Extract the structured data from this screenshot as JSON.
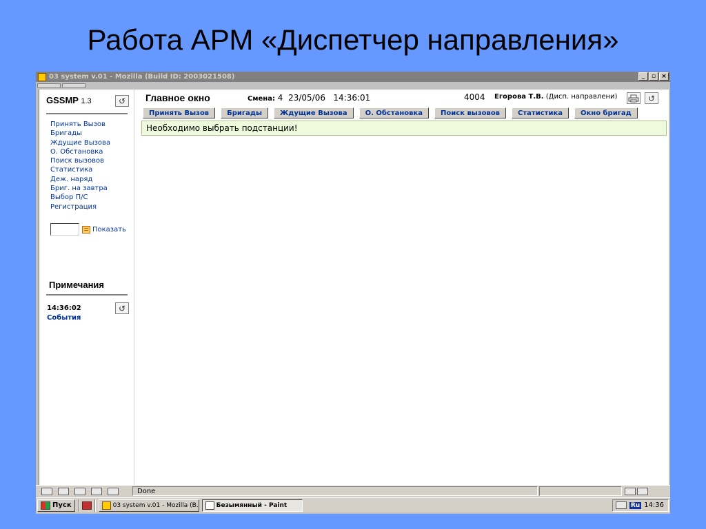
{
  "slide": {
    "title": "Работа АРМ «Диспетчер направления»"
  },
  "window": {
    "title": "03 system v.01 - Mozilla (Build ID: 2003021508)",
    "min_label": "_",
    "max_label": "▫",
    "close_label": "×"
  },
  "sidebar": {
    "brand": "GSSMP",
    "version": "1.3",
    "refresh_glyph": "↺",
    "items": [
      {
        "label": "Принять Вызов"
      },
      {
        "label": "Бригады"
      },
      {
        "label": "Ждущие Вызова"
      },
      {
        "label": "О. Обстановка"
      },
      {
        "label": "Поиск вызовов"
      },
      {
        "label": "Статистика"
      },
      {
        "label": "Деж. наряд"
      },
      {
        "label": "Бриг. на завтра"
      },
      {
        "label": "Выбор П/С"
      },
      {
        "label": "Регистрация"
      }
    ],
    "show_label": "Показать",
    "notes_title": "Примечания",
    "note_time": "14:36:02",
    "events_label": "События"
  },
  "header": {
    "title": "Главное окно",
    "shift_label": "Смена:",
    "shift_value": "4",
    "date": "23/05/06",
    "time": "14:36:01",
    "code": "4004",
    "user_name": "Егорова Т.В.",
    "user_role": "(Дисп. направлени)"
  },
  "nav": {
    "buttons": [
      {
        "label": "Принять Вызов"
      },
      {
        "label": "Бригады"
      },
      {
        "label": "Ждущие Вызова"
      },
      {
        "label": "О. Обстановка"
      },
      {
        "label": "Поиск вызовов"
      },
      {
        "label": "Статистика"
      },
      {
        "label": "Окно бригад"
      }
    ]
  },
  "message": "Необходимо выбрать подстанции!",
  "statusbar": {
    "text": "Done"
  },
  "taskbar": {
    "start_label": "Пуск",
    "items": [
      {
        "label": "03 system v.01 - Mozilla (B..."
      },
      {
        "label": "Безымянный - Paint"
      }
    ],
    "lang": "Ru",
    "clock": "14:36"
  },
  "colors": {
    "background": "#6699ff",
    "link": "#003399",
    "message_bg": "#eefadc"
  }
}
